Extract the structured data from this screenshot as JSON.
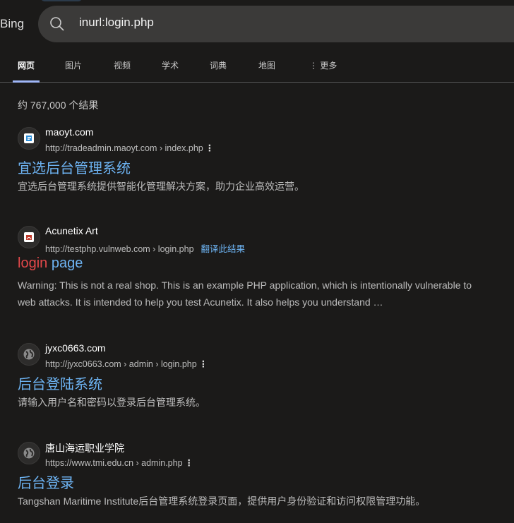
{
  "brand": "Bing",
  "search": {
    "query": "inurl:login.php"
  },
  "tabs": [
    "网页",
    "图片",
    "视频",
    "学术",
    "词典",
    "地图",
    "更多"
  ],
  "result_count": "约 767,000 个结果",
  "results": [
    {
      "site": "maoyt.com",
      "url": "http://tradeadmin.maoyt.com › index.php",
      "title": "宜选后台管理系统",
      "snippet": "宜选后台管理系统提供智能化管理解决方案，助力企业高效运营。",
      "favicon": "maoyt-icon"
    },
    {
      "site": "Acunetix Art",
      "url": "http://testphp.vulnweb.com › login.php",
      "translate": "翻译此结果",
      "title_hl": "login",
      "title_rest": " page",
      "snippet": "Warning: This is not a real shop. This is an example PHP application, which is intentionally vulnerable to web attacks. It is intended to help you test Acunetix. It also helps you understand …",
      "favicon": "acunetix-icon"
    },
    {
      "site": "jyxc0663.com",
      "url": "http://jyxc0663.com › admin › login.php",
      "title": "后台登陆系统",
      "snippet": "请输入用户名和密码以登录后台管理系统。",
      "favicon": "globe-icon"
    },
    {
      "site": "唐山海运职业学院",
      "url": "https://www.tmi.edu.cn › admin.php",
      "title": "后台登录",
      "snippet": "Tangshan Maritime Institute后台管理系统登录页面，提供用户身份验证和访问权限管理功能。",
      "favicon": "globe-icon"
    }
  ],
  "colors": {
    "link": "#6db3f2",
    "highlight": "#e2484a",
    "bg": "#1b1a19"
  }
}
